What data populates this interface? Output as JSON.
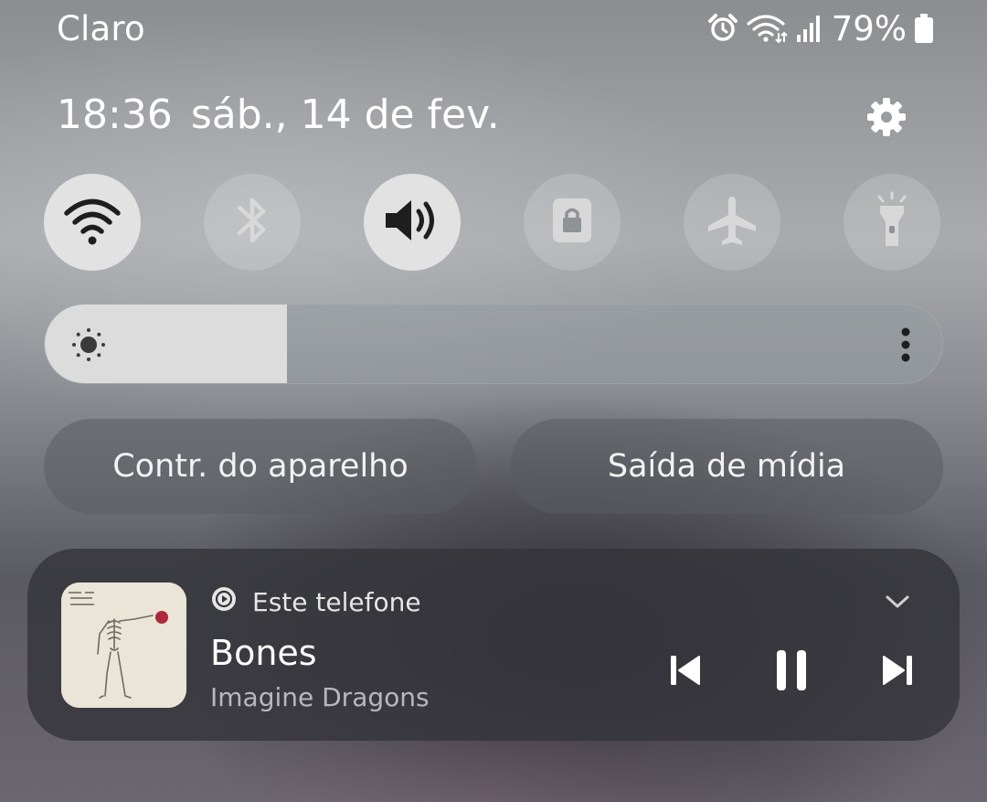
{
  "status_bar": {
    "carrier": "Claro",
    "battery_percent": "79%",
    "icons": [
      "alarm-icon",
      "wifi-icon",
      "signal-icon",
      "battery-icon"
    ]
  },
  "header": {
    "time": "18:36",
    "date": "sáb., 14 de fev."
  },
  "quick_settings": [
    {
      "name": "wifi",
      "icon": "wifi-icon",
      "state": "on"
    },
    {
      "name": "bluetooth",
      "icon": "bluetooth-icon",
      "state": "off"
    },
    {
      "name": "sound",
      "icon": "volume-icon",
      "state": "on"
    },
    {
      "name": "screen-lock",
      "icon": "lock-icon",
      "state": "off"
    },
    {
      "name": "airplane-mode",
      "icon": "airplane-icon",
      "state": "off"
    },
    {
      "name": "flashlight",
      "icon": "flashlight-icon",
      "state": "off"
    }
  ],
  "brightness": {
    "level": 0.27
  },
  "buttons": {
    "device_control": "Contr. do aparelho",
    "media_output": "Saída de mídia"
  },
  "media": {
    "output_device": "Este telefone",
    "title": "Bones",
    "artist": "Imagine Dragons"
  },
  "colors": {
    "tile_on": "#e2e2e2",
    "tile_off": "rgba(255,255,255,0.16)",
    "card": "#34343a"
  }
}
